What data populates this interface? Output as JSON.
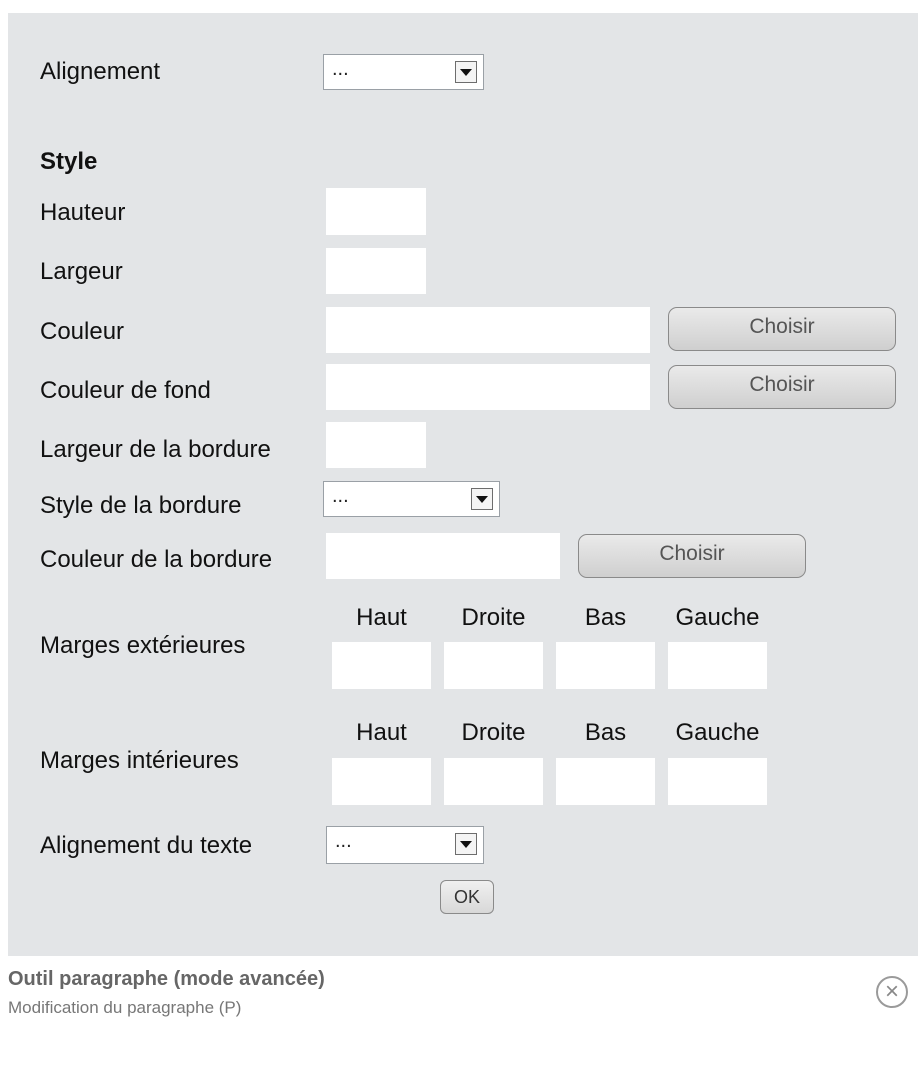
{
  "alignment": {
    "label": "Alignement",
    "value": "..."
  },
  "style_heading": "Style",
  "height_label": "Hauteur",
  "width_label": "Largeur",
  "color_label": "Couleur",
  "bgcolor_label": "Couleur de fond",
  "border_width_label": "Largeur de la bordure",
  "border_style": {
    "label": "Style de la bordure",
    "value": "..."
  },
  "border_color_label": "Couleur de la bordure",
  "choose_label": "Choisir",
  "margin_columns": [
    "Haut",
    "Droite",
    "Bas",
    "Gauche"
  ],
  "outer_margins_label": "Marges extérieures",
  "inner_margins_label": "Marges intérieures",
  "text_align": {
    "label": "Alignement du texte",
    "value": "..."
  },
  "ok_label": "OK",
  "footer": {
    "title": "Outil paragraphe (mode avancée)",
    "subtitle": "Modification du paragraphe (P)"
  },
  "icons": {
    "close": "close-icon"
  }
}
